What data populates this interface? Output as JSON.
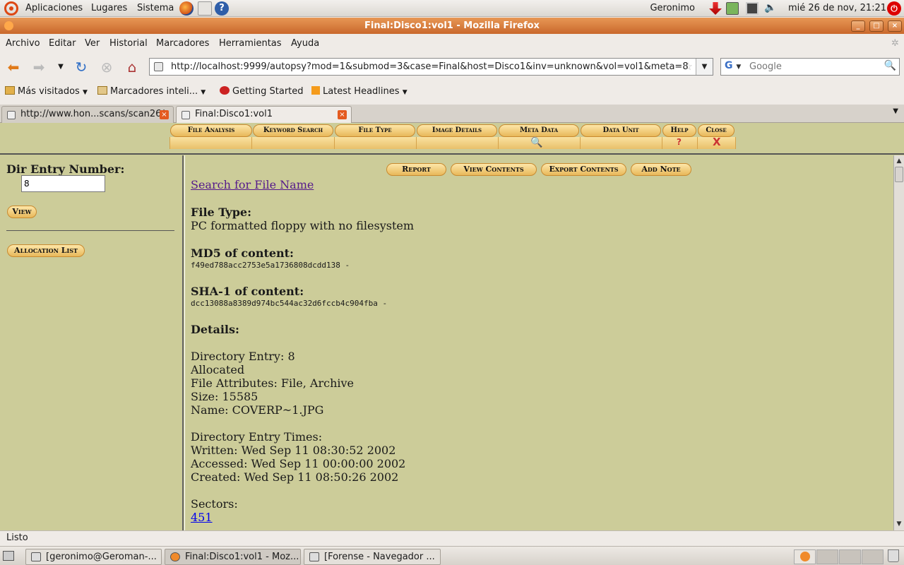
{
  "gnome_panel": {
    "menus": [
      "Aplicaciones",
      "Lugares",
      "Sistema"
    ],
    "user": "Geronimo",
    "clock": "mié 26 de nov, 21:21"
  },
  "window": {
    "title": "Final:Disco1:vol1 - Mozilla Firefox"
  },
  "firefox_menu": [
    "Archivo",
    "Editar",
    "Ver",
    "Historial",
    "Marcadores",
    "Herramientas",
    "Ayuda"
  ],
  "url_bar": {
    "value": "http://localhost:9999/autopsy?mod=1&submod=3&case=Final&host=Disco1&inv=unknown&vol=vol1&meta=8"
  },
  "search": {
    "placeholder": "Google",
    "engine": "G"
  },
  "bookmarks": {
    "items": [
      "Más visitados",
      "Marcadores inteli...",
      "Getting Started",
      "Latest Headlines"
    ]
  },
  "tabs": [
    {
      "label": "http://www.hon...scans/scan26/",
      "active": false
    },
    {
      "label": "Final:Disco1:vol1",
      "active": true
    }
  ],
  "autopsy_menu": {
    "items": [
      "File Analysis",
      "Keyword Search",
      "File Type",
      "Image Details",
      "Meta Data",
      "Data Unit",
      "Help",
      "Close"
    ],
    "help_glyph": "?",
    "close_glyph": "X"
  },
  "left_panel": {
    "label": "Dir Entry Number:",
    "input_value": "8",
    "view_button": "View",
    "allocation_button": "Allocation List"
  },
  "actions": [
    "Report",
    "View Contents",
    "Export Contents",
    "Add Note"
  ],
  "details": {
    "search_link": "Search for File Name",
    "file_type_heading": "File Type:",
    "file_type_value": "PC formatted floppy with no filesystem",
    "md5_heading": "MD5 of content:",
    "md5_value": "f49ed788acc2753e5a1736808dcdd138 -",
    "sha1_heading": "SHA-1 of content:",
    "sha1_value": "dcc13088a8389d974bc544ac32d6fccb4c904fba -",
    "details_heading": "Details:",
    "lines": [
      "Directory Entry: 8",
      "Allocated",
      "File Attributes: File, Archive",
      "Size: 15585",
      "Name: COVERP~1.JPG"
    ],
    "times_heading": "Directory Entry Times:",
    "times": [
      "Written: Wed Sep 11 08:30:52 2002",
      "Accessed: Wed Sep 11 00:00:00 2002",
      "Created: Wed Sep 11 08:50:26 2002"
    ],
    "sectors_heading": "Sectors:",
    "sector_link": "451"
  },
  "status": "Listo",
  "taskbar": {
    "items": [
      {
        "label": "[geronimo@Geroman-...",
        "active": false
      },
      {
        "label": "Final:Disco1:vol1 - Moz...",
        "active": true
      },
      {
        "label": "[Forense - Navegador ...",
        "active": false
      }
    ]
  },
  "colors": {
    "page_bg": "#cccc99",
    "titlebar": "#d97a38",
    "button_gold": "#e8b85a"
  }
}
